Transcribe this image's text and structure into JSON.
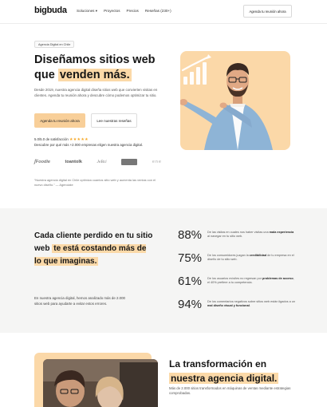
{
  "nav": {
    "logo": "bigbuda",
    "items": [
      {
        "label": "Soluciones ▾"
      },
      {
        "label": "Proyectos"
      },
      {
        "label": "Precios"
      },
      {
        "label": "Reseñas (230+)"
      }
    ],
    "cta": "Agenda tu reunión ahora"
  },
  "hero": {
    "badge": "Agencia Digital en Chile",
    "title_line1": "Diseñamos sitios web",
    "title_line2_plain": "que ",
    "title_line2_highlight": "venden más.",
    "lede": "Desde 2019, nuestra agencia digital diseña sitios web que convierten visitas en clientes. Agenda tu reunión ahora y descubre cómo podemos optimizar tu sitio.",
    "cta_primary": "Agenda tu reunión ahora",
    "cta_secondary": "Lee nuestras reseñas",
    "rating_text": "5.0/5.0 de satisfacción",
    "stars": "★★★★★",
    "rating_sub": "Descubre por qué más +2.000 empresas eligen nuestra agencia digital.",
    "client_logos": [
      "Foodie",
      "toantolk",
      "JeBci",
      "[logo]",
      "ene"
    ],
    "quote": "“Nuestra agencia digital en Chile optimiza cuantos sitio web y aumenta las ventas con el nuevo diseño.” — Agenciate"
  },
  "stats": {
    "title_plain1": "Cada cliente perdido en tu sitio web ",
    "title_highlight": "te está costando más de lo que imaginas.",
    "intro": "En nuestra agencia digital, hemos analizado más de 2.000 sitios web para ayudarte a evitar estos errores.",
    "items": [
      {
        "value": "88%",
        "text_pre": "De las visitas en cuales nos haber visitas una ",
        "text_bold": "mala experiencia",
        "text_post": " al navegar en tu sitio web."
      },
      {
        "value": "75%",
        "text_pre": "De los consumidores juzgan la ",
        "text_bold": "credibilidad",
        "text_post": " de tu empresa en el diseño de tu sitio web."
      },
      {
        "value": "61%",
        "text_pre": "De los usuarios móviles no regresan por ",
        "text_bold": "problemas de acceso",
        "text_post": ", el 40% prefiere a tu competencia."
      },
      {
        "value": "94%",
        "text_pre": "De los comentarios negativos sobre sitios web están ligados a un ",
        "text_bold": "mal diseño visual y funcional",
        "text_post": "."
      }
    ]
  },
  "transform": {
    "title_plain": "La transformación en ",
    "title_highlight": "nuestra agencia digital.",
    "text": "Más de 2.000 sitios transformados en máquinas de ventas mediante estrategias comprobadas."
  },
  "colors": {
    "accent": "#fbd9a8",
    "stars": "#f5a623",
    "stats_bg": "#f5f5f4"
  }
}
